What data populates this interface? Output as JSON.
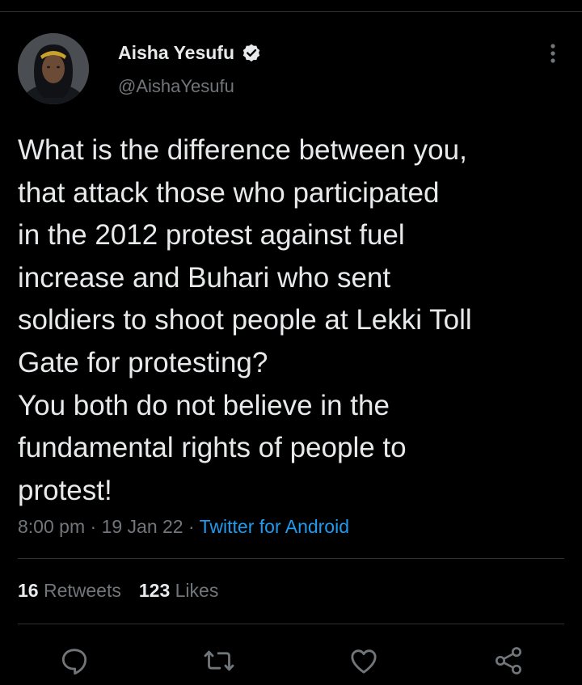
{
  "author": {
    "display_name": "Aisha Yesufu",
    "handle": "@AishaYesufu",
    "verified": true
  },
  "tweet": {
    "text": "What is the difference between you,\nthat attack those who participated\nin the 2012 protest against fuel\nincrease and Buhari who sent\nsoldiers to shoot people at Lekki Toll\nGate for protesting?\nYou both do not believe in the\nfundamental rights of people to\nprotest!",
    "time": "8:00 pm",
    "date": "19 Jan 22",
    "separator": "·",
    "source": "Twitter for Android"
  },
  "stats": {
    "retweets_count": "16",
    "retweets_label": "Retweets",
    "likes_count": "123",
    "likes_label": "Likes"
  },
  "actions": [
    "reply-icon",
    "retweet-icon",
    "like-icon",
    "share-icon"
  ],
  "colors": {
    "background": "#000000",
    "text": "#e7e9ea",
    "secondary": "#71767b",
    "accent": "#1d9bf0",
    "divider": "#2f3336"
  }
}
